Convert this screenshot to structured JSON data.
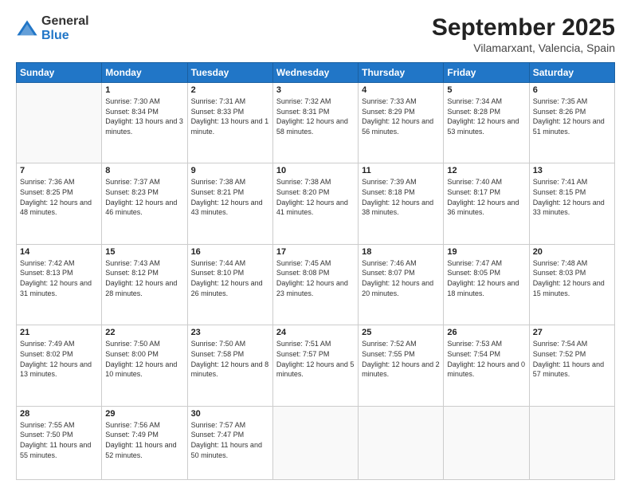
{
  "header": {
    "logo_general": "General",
    "logo_blue": "Blue",
    "title": "September 2025",
    "subtitle": "Vilamarxant, Valencia, Spain"
  },
  "days_of_week": [
    "Sunday",
    "Monday",
    "Tuesday",
    "Wednesday",
    "Thursday",
    "Friday",
    "Saturday"
  ],
  "weeks": [
    {
      "days": [
        {
          "num": "",
          "empty": true
        },
        {
          "num": "1",
          "sunrise": "Sunrise: 7:30 AM",
          "sunset": "Sunset: 8:34 PM",
          "daylight": "Daylight: 13 hours and 3 minutes."
        },
        {
          "num": "2",
          "sunrise": "Sunrise: 7:31 AM",
          "sunset": "Sunset: 8:33 PM",
          "daylight": "Daylight: 13 hours and 1 minute."
        },
        {
          "num": "3",
          "sunrise": "Sunrise: 7:32 AM",
          "sunset": "Sunset: 8:31 PM",
          "daylight": "Daylight: 12 hours and 58 minutes."
        },
        {
          "num": "4",
          "sunrise": "Sunrise: 7:33 AM",
          "sunset": "Sunset: 8:29 PM",
          "daylight": "Daylight: 12 hours and 56 minutes."
        },
        {
          "num": "5",
          "sunrise": "Sunrise: 7:34 AM",
          "sunset": "Sunset: 8:28 PM",
          "daylight": "Daylight: 12 hours and 53 minutes."
        },
        {
          "num": "6",
          "sunrise": "Sunrise: 7:35 AM",
          "sunset": "Sunset: 8:26 PM",
          "daylight": "Daylight: 12 hours and 51 minutes."
        }
      ]
    },
    {
      "days": [
        {
          "num": "7",
          "sunrise": "Sunrise: 7:36 AM",
          "sunset": "Sunset: 8:25 PM",
          "daylight": "Daylight: 12 hours and 48 minutes."
        },
        {
          "num": "8",
          "sunrise": "Sunrise: 7:37 AM",
          "sunset": "Sunset: 8:23 PM",
          "daylight": "Daylight: 12 hours and 46 minutes."
        },
        {
          "num": "9",
          "sunrise": "Sunrise: 7:38 AM",
          "sunset": "Sunset: 8:21 PM",
          "daylight": "Daylight: 12 hours and 43 minutes."
        },
        {
          "num": "10",
          "sunrise": "Sunrise: 7:38 AM",
          "sunset": "Sunset: 8:20 PM",
          "daylight": "Daylight: 12 hours and 41 minutes."
        },
        {
          "num": "11",
          "sunrise": "Sunrise: 7:39 AM",
          "sunset": "Sunset: 8:18 PM",
          "daylight": "Daylight: 12 hours and 38 minutes."
        },
        {
          "num": "12",
          "sunrise": "Sunrise: 7:40 AM",
          "sunset": "Sunset: 8:17 PM",
          "daylight": "Daylight: 12 hours and 36 minutes."
        },
        {
          "num": "13",
          "sunrise": "Sunrise: 7:41 AM",
          "sunset": "Sunset: 8:15 PM",
          "daylight": "Daylight: 12 hours and 33 minutes."
        }
      ]
    },
    {
      "days": [
        {
          "num": "14",
          "sunrise": "Sunrise: 7:42 AM",
          "sunset": "Sunset: 8:13 PM",
          "daylight": "Daylight: 12 hours and 31 minutes."
        },
        {
          "num": "15",
          "sunrise": "Sunrise: 7:43 AM",
          "sunset": "Sunset: 8:12 PM",
          "daylight": "Daylight: 12 hours and 28 minutes."
        },
        {
          "num": "16",
          "sunrise": "Sunrise: 7:44 AM",
          "sunset": "Sunset: 8:10 PM",
          "daylight": "Daylight: 12 hours and 26 minutes."
        },
        {
          "num": "17",
          "sunrise": "Sunrise: 7:45 AM",
          "sunset": "Sunset: 8:08 PM",
          "daylight": "Daylight: 12 hours and 23 minutes."
        },
        {
          "num": "18",
          "sunrise": "Sunrise: 7:46 AM",
          "sunset": "Sunset: 8:07 PM",
          "daylight": "Daylight: 12 hours and 20 minutes."
        },
        {
          "num": "19",
          "sunrise": "Sunrise: 7:47 AM",
          "sunset": "Sunset: 8:05 PM",
          "daylight": "Daylight: 12 hours and 18 minutes."
        },
        {
          "num": "20",
          "sunrise": "Sunrise: 7:48 AM",
          "sunset": "Sunset: 8:03 PM",
          "daylight": "Daylight: 12 hours and 15 minutes."
        }
      ]
    },
    {
      "days": [
        {
          "num": "21",
          "sunrise": "Sunrise: 7:49 AM",
          "sunset": "Sunset: 8:02 PM",
          "daylight": "Daylight: 12 hours and 13 minutes."
        },
        {
          "num": "22",
          "sunrise": "Sunrise: 7:50 AM",
          "sunset": "Sunset: 8:00 PM",
          "daylight": "Daylight: 12 hours and 10 minutes."
        },
        {
          "num": "23",
          "sunrise": "Sunrise: 7:50 AM",
          "sunset": "Sunset: 7:58 PM",
          "daylight": "Daylight: 12 hours and 8 minutes."
        },
        {
          "num": "24",
          "sunrise": "Sunrise: 7:51 AM",
          "sunset": "Sunset: 7:57 PM",
          "daylight": "Daylight: 12 hours and 5 minutes."
        },
        {
          "num": "25",
          "sunrise": "Sunrise: 7:52 AM",
          "sunset": "Sunset: 7:55 PM",
          "daylight": "Daylight: 12 hours and 2 minutes."
        },
        {
          "num": "26",
          "sunrise": "Sunrise: 7:53 AM",
          "sunset": "Sunset: 7:54 PM",
          "daylight": "Daylight: 12 hours and 0 minutes."
        },
        {
          "num": "27",
          "sunrise": "Sunrise: 7:54 AM",
          "sunset": "Sunset: 7:52 PM",
          "daylight": "Daylight: 11 hours and 57 minutes."
        }
      ]
    },
    {
      "days": [
        {
          "num": "28",
          "sunrise": "Sunrise: 7:55 AM",
          "sunset": "Sunset: 7:50 PM",
          "daylight": "Daylight: 11 hours and 55 minutes."
        },
        {
          "num": "29",
          "sunrise": "Sunrise: 7:56 AM",
          "sunset": "Sunset: 7:49 PM",
          "daylight": "Daylight: 11 hours and 52 minutes."
        },
        {
          "num": "30",
          "sunrise": "Sunrise: 7:57 AM",
          "sunset": "Sunset: 7:47 PM",
          "daylight": "Daylight: 11 hours and 50 minutes."
        },
        {
          "num": "",
          "empty": true
        },
        {
          "num": "",
          "empty": true
        },
        {
          "num": "",
          "empty": true
        },
        {
          "num": "",
          "empty": true
        }
      ]
    }
  ]
}
